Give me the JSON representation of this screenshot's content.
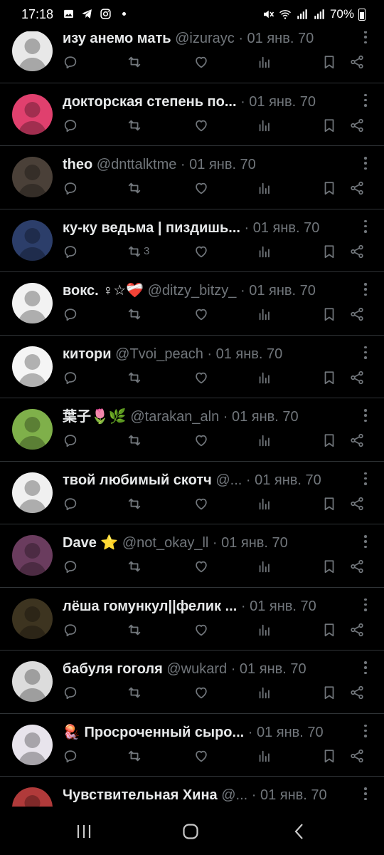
{
  "status_bar": {
    "time": "17:18",
    "battery": "70%",
    "left_icons": [
      "gallery-icon",
      "telegram-icon",
      "instagram-icon"
    ],
    "right_icons": [
      "mute-icon",
      "wifi-icon",
      "signal-icon",
      "signal-2-icon",
      "battery-icon"
    ]
  },
  "tweets": [
    {
      "name": "изу анемо мать",
      "handle": "@izurayc",
      "date": "· 01 янв. 70",
      "retweets": "",
      "avatar_color": "#e8e8e8"
    },
    {
      "name": "докторская степень по...",
      "handle": "",
      "date": "· 01 янв. 70",
      "retweets": "",
      "avatar_color": "#e0406e"
    },
    {
      "name": "theo",
      "handle": "@dnttalktme",
      "date": "· 01 янв. 70",
      "retweets": "",
      "avatar_color": "#4a4038"
    },
    {
      "name": "ку-ку ведьма | пиздишь...",
      "handle": "",
      "date": "· 01 янв. 70",
      "retweets": "3",
      "avatar_color": "#2c3e6a"
    },
    {
      "name": "вокс. ♀☆❤️‍🩹",
      "handle": "@ditzy_bitzy_",
      "date": "· 01 янв. 70",
      "retweets": "",
      "avatar_color": "#f2f2f2"
    },
    {
      "name": "китори",
      "handle": "@Tvoi_peach",
      "date": "· 01 янв. 70",
      "retweets": "",
      "avatar_color": "#f5f5f5"
    },
    {
      "name": "葉子🌷🌿",
      "handle": "@tarakan_aln",
      "date": "· 01 янв. 70",
      "retweets": "",
      "avatar_color": "#7fb04a"
    },
    {
      "name": "твой любимый скотч",
      "handle": "@...",
      "date": "· 01 янв. 70",
      "retweets": "",
      "avatar_color": "#f0f0f0"
    },
    {
      "name": "Dave ⭐",
      "handle": "@not_okay_ll",
      "date": "· 01 янв. 70",
      "retweets": "",
      "avatar_color": "#6a3c5e"
    },
    {
      "name": "лёша гомункул||фелик ...",
      "handle": "",
      "date": "· 01 янв. 70",
      "retweets": "",
      "avatar_color": "#3d3420"
    },
    {
      "name": "бабуля гоголя",
      "handle": "@wukard",
      "date": "· 01 янв. 70",
      "retweets": "",
      "avatar_color": "#dcdcdc"
    },
    {
      "name": "🪼 Просроченный сыро...",
      "handle": "",
      "date": "· 01 янв. 70",
      "retweets": "",
      "avatar_color": "#e8e4ec"
    },
    {
      "name": "Чувствительная Хина",
      "handle": "@...",
      "date": "· 01 янв. 70",
      "retweets": "",
      "avatar_color": "#b03a3a"
    }
  ],
  "navigation": {
    "buttons": [
      "recent-apps-icon",
      "home-icon",
      "back-icon"
    ]
  }
}
